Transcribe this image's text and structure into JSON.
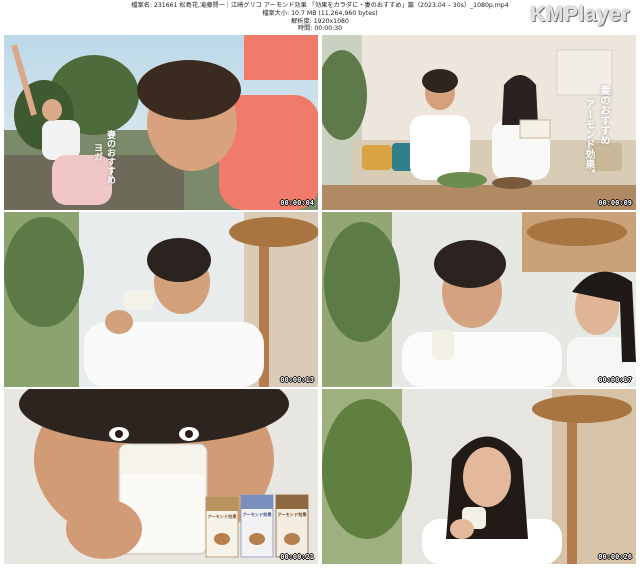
{
  "header": {
    "file_line": "檔案名: 231661 松島花,滝藤賢一｜江崎グリコ アーモンド効果 「効果をカラダに・妻のおすすめ」篇（2023.04 – 30s）_1080p.mp4",
    "size_line": "檔案大小: 10.7 MB (11,264,960 bytes)",
    "res_line": "解析度: 1920x1080",
    "dur_line": "時間: 00:00:30",
    "logo": "KMPlayer"
  },
  "thumbnails": [
    {
      "time": "00:00:04",
      "caption_main": "妻のおすすめ",
      "caption_sub": "ヨガ"
    },
    {
      "time": "00:00:09",
      "caption_main": "妻のおすすめ",
      "caption_sub": "アーモンド効果。"
    },
    {
      "time": "00:00:13"
    },
    {
      "time": "00:00:17"
    },
    {
      "time": "00:00:21",
      "pack_text": "アーモンド効果"
    },
    {
      "time": "00:00:26"
    }
  ],
  "colors": {
    "logo": "#e3e3e3"
  }
}
